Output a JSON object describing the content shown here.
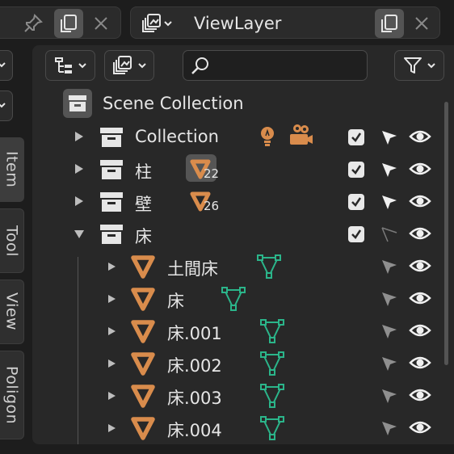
{
  "header": {
    "view_layer_name": "ViewLayer",
    "icons": [
      "pin-icon",
      "duplicate-icon",
      "close-icon",
      "render-layers-icon",
      "duplicate-icon",
      "close-icon"
    ]
  },
  "side_tabs": [
    {
      "label": "Item",
      "active": true
    },
    {
      "label": "Tool",
      "active": false
    },
    {
      "label": "View",
      "active": false
    },
    {
      "label": "Poligon",
      "active": false
    }
  ],
  "outliner": {
    "search": {
      "value": "",
      "placeholder": ""
    },
    "scene_collection": "Scene Collection",
    "rows": [
      {
        "label": "Collection",
        "kind": "collection",
        "expanded": false,
        "checked": true,
        "selectable": true,
        "extras": [
          "light-icon",
          "camera-icon"
        ]
      },
      {
        "label": "柱",
        "kind": "collection",
        "expanded": false,
        "checked": true,
        "selectable": true,
        "badge_count": "22"
      },
      {
        "label": "壁",
        "kind": "collection",
        "expanded": false,
        "checked": true,
        "selectable": true,
        "badge_count": "26"
      },
      {
        "label": "床",
        "kind": "collection",
        "expanded": true,
        "checked": true,
        "selectable": false
      },
      {
        "label": "土間床",
        "kind": "mesh"
      },
      {
        "label": "床",
        "kind": "mesh"
      },
      {
        "label": "床.001",
        "kind": "mesh"
      },
      {
        "label": "床.002",
        "kind": "mesh"
      },
      {
        "label": "床.003",
        "kind": "mesh"
      },
      {
        "label": "床.004",
        "kind": "mesh"
      }
    ]
  },
  "colors": {
    "accent_orange": "#d98c4c",
    "mesh_green": "#2bb58a"
  }
}
